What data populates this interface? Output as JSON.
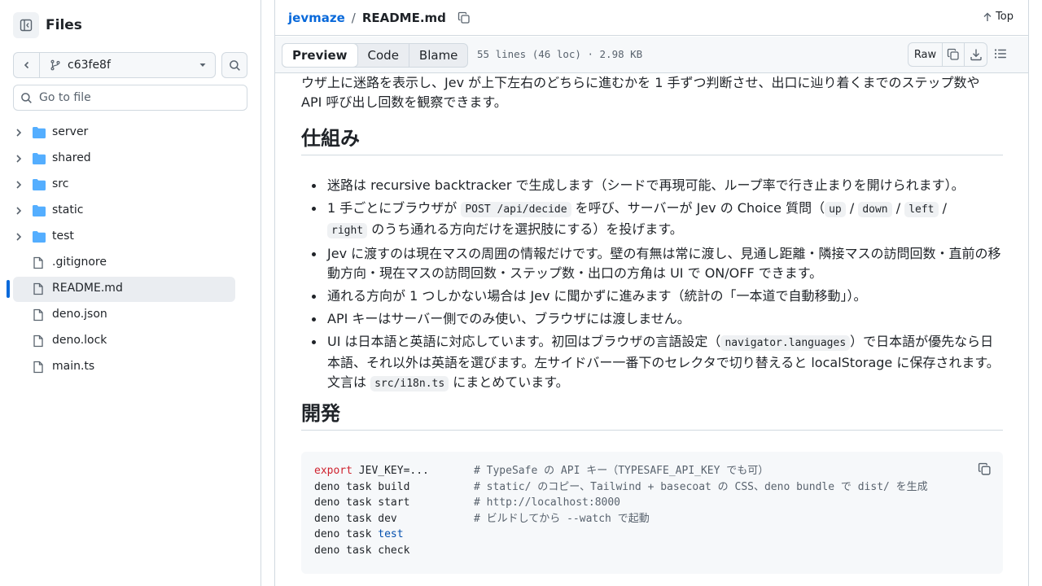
{
  "sidebar": {
    "title": "Files",
    "branch": "c63fe8f",
    "goto_placeholder": "Go to file",
    "items": [
      {
        "label": "server",
        "type": "folder"
      },
      {
        "label": "shared",
        "type": "folder"
      },
      {
        "label": "src",
        "type": "folder"
      },
      {
        "label": "static",
        "type": "folder"
      },
      {
        "label": "test",
        "type": "folder"
      },
      {
        "label": ".gitignore",
        "type": "file"
      },
      {
        "label": "README.md",
        "type": "file",
        "active": true
      },
      {
        "label": "deno.json",
        "type": "file"
      },
      {
        "label": "deno.lock",
        "type": "file"
      },
      {
        "label": "main.ts",
        "type": "file"
      }
    ]
  },
  "breadcrumb": {
    "repo": "jevmaze",
    "separator": "/",
    "file": "README.md",
    "top_label": "Top"
  },
  "toolbar": {
    "tabs": [
      "Preview",
      "Code",
      "Blame"
    ],
    "active_tab": "Preview",
    "meta": "55 lines (46 loc) · 2.98 KB",
    "raw_label": "Raw"
  },
  "readme": {
    "intro_line1": "ウザ上に迷路を表示し、Jev が上下左右のどちらに進むかを 1 手ずつ判断させ、出口に辿り着くまでのステップ数や",
    "intro_line2": "API 呼び出し回数を観察できます。",
    "section1_title": "仕組み",
    "b1": "迷路は recursive backtracker で生成します（シードで再現可能、ループ率で行き止まりを開けられます）。",
    "b2_a": "1 手ごとにブラウザが ",
    "b2_code1": "POST /api/decide",
    "b2_b": " を呼び、サーバーが Jev の Choice 質問（",
    "b2_code2": "up",
    "b2_sep1": " / ",
    "b2_code3": "down",
    "b2_sep2": " / ",
    "b2_code4": "left",
    "b2_sep3": " /",
    "b2_code5": "right",
    "b2_c": " のうち通れる方向だけを選択肢にする）を投げます。",
    "b3": "Jev に渡すのは現在マスの周囲の情報だけです。壁の有無は常に渡し、見通し距離・隣接マスの訪問回数・直前の移動方向・現在マスの訪問回数・ステップ数・出口の方角は UI で ON/OFF できます。",
    "b4": "通れる方向が 1 つしかない場合は Jev に聞かずに進みます（統計の「一本道で自動移動」）。",
    "b5": "API キーはサーバー側でのみ使い、ブラウザには渡しません。",
    "b6_a": "UI は日本語と英語に対応しています。初回はブラウザの言語設定（",
    "b6_code1": "navigator.languages",
    "b6_b": "）で日本語が優先なら日本語、それ以外は英語を選びます。左サイドバー一番下のセレクタで切り替えると localStorage に保存されます。文言は ",
    "b6_code2": "src/i18n.ts",
    "b6_c": " にまとめています。",
    "section2_title": "開発"
  },
  "code": {
    "l1_kw": "export",
    "l1_rest": " JEV_KEY=...",
    "l1_cmt": "# TypeSafe の API キー（TYPESAFE_API_KEY でも可）",
    "l2": "deno task build",
    "l2_cmt": "# static/ のコピー、Tailwind + basecoat の CSS、deno bundle で dist/ を生成",
    "l3": "deno task start",
    "l3_cmt": "# http://localhost:8000",
    "l4": "deno task dev",
    "l4_cmt": "# ビルドしてから --watch で起動",
    "l5_a": "deno task ",
    "l5_b": "test",
    "l6": "deno task check"
  }
}
